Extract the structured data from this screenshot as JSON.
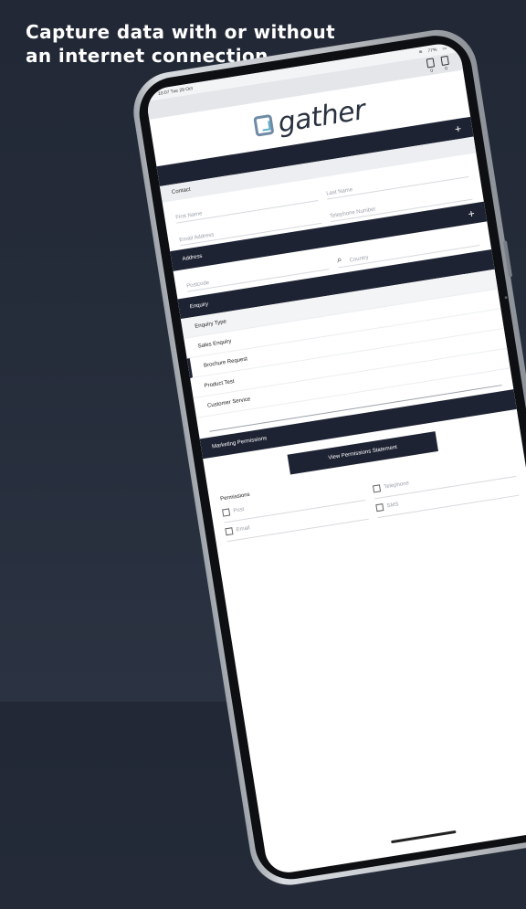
{
  "headline": {
    "line1": "Capture data with or without",
    "line2": "an internet connection"
  },
  "status": {
    "time": "10:07",
    "date": "Tue 29 Oct",
    "battery": "77%"
  },
  "counters": [
    {
      "value": "0"
    },
    {
      "value": "0"
    }
  ],
  "brand": "gather",
  "sections": {
    "top_plus": "+",
    "contact": "Contact",
    "address": "Address",
    "address_plus": "+",
    "enquiry": "Enquiry",
    "marketing": "Marketing Permissions"
  },
  "contact_fields": {
    "last_name": "Last Name",
    "first_name": "First Name",
    "telephone": "Telephone Number",
    "email": "Email Address"
  },
  "address_fields": {
    "country": "Country",
    "postcode": "Postcode"
  },
  "enquiry_list": {
    "header": "Enquiry Type",
    "items": [
      "Sales Enquiry",
      "Brochure Request",
      "Product Test",
      "Customer Service"
    ]
  },
  "permissions": {
    "button": "View Permissions Statement",
    "title": "Permissions",
    "options": [
      "Post",
      "Telephone",
      "Email",
      "SMS"
    ]
  }
}
